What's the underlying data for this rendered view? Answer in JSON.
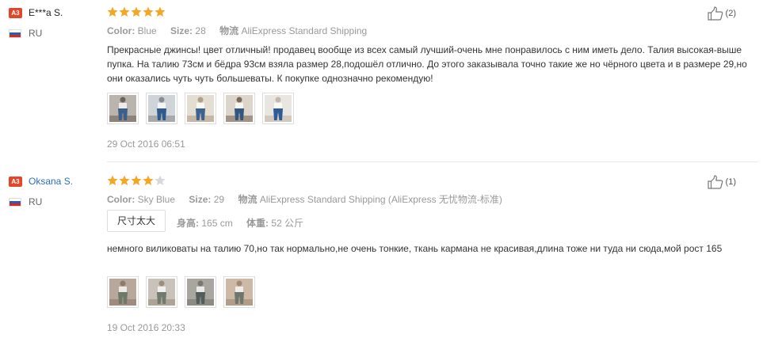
{
  "reviews": [
    {
      "badge": "A3",
      "user_name": "E***a S.",
      "country": "RU",
      "rating": 5,
      "max_rating": 5,
      "likes": "(2)",
      "attrs": {
        "color_label": "Color:",
        "color_value": "Blue",
        "size_label": "Size:",
        "size_value": "28",
        "shipping_label": "物流",
        "shipping_value": "AliExpress Standard Shipping"
      },
      "text": "Прекрасные джинсы! цвет отличный! продавец вообще из всех самый лучший-очень мне понравилось с ним иметь дело. Талия высокая-выше пупка. На талию 73см и бёдра 93см взяла размер 28,подошёл отлично. До этого заказывала точно такие же но чёрного цвета и в размере 29,но они оказались чуть чуть большеваты. К покупке однозначно рекомендую!",
      "photo_count": 5,
      "date": "29 Oct 2016 06:51"
    },
    {
      "badge": "A3",
      "user_name": "Oksana S.",
      "country": "RU",
      "rating": 4,
      "max_rating": 5,
      "likes": "(1)",
      "attrs": {
        "color_label": "Color:",
        "color_value": "Sky Blue",
        "size_label": "Size:",
        "size_value": "29",
        "shipping_label": "物流",
        "shipping_value": "AliExpress Standard Shipping (AliExpress 无忧物流-标准)"
      },
      "fit": "尺寸太大",
      "height_label": "身高:",
      "height_value": "165 cm",
      "weight_label": "体重:",
      "weight_value": "52 公斤",
      "text": "немного виликоваты на талию 70,но так нормально,не очень тонкие, ткань кармана не красивая,длина тоже ни туда ни сюда,мой рост 165",
      "photo_count": 4,
      "date": "19 Oct 2016 20:33"
    }
  ],
  "colors": {
    "star_on": "#f5a623",
    "star_off": "#d8d8d8",
    "badge": "#e2462b",
    "link": "#2a6ebb"
  },
  "icons": {
    "like": "thumbs-up-icon",
    "star": "star-icon",
    "flag": "russia-flag-icon"
  }
}
